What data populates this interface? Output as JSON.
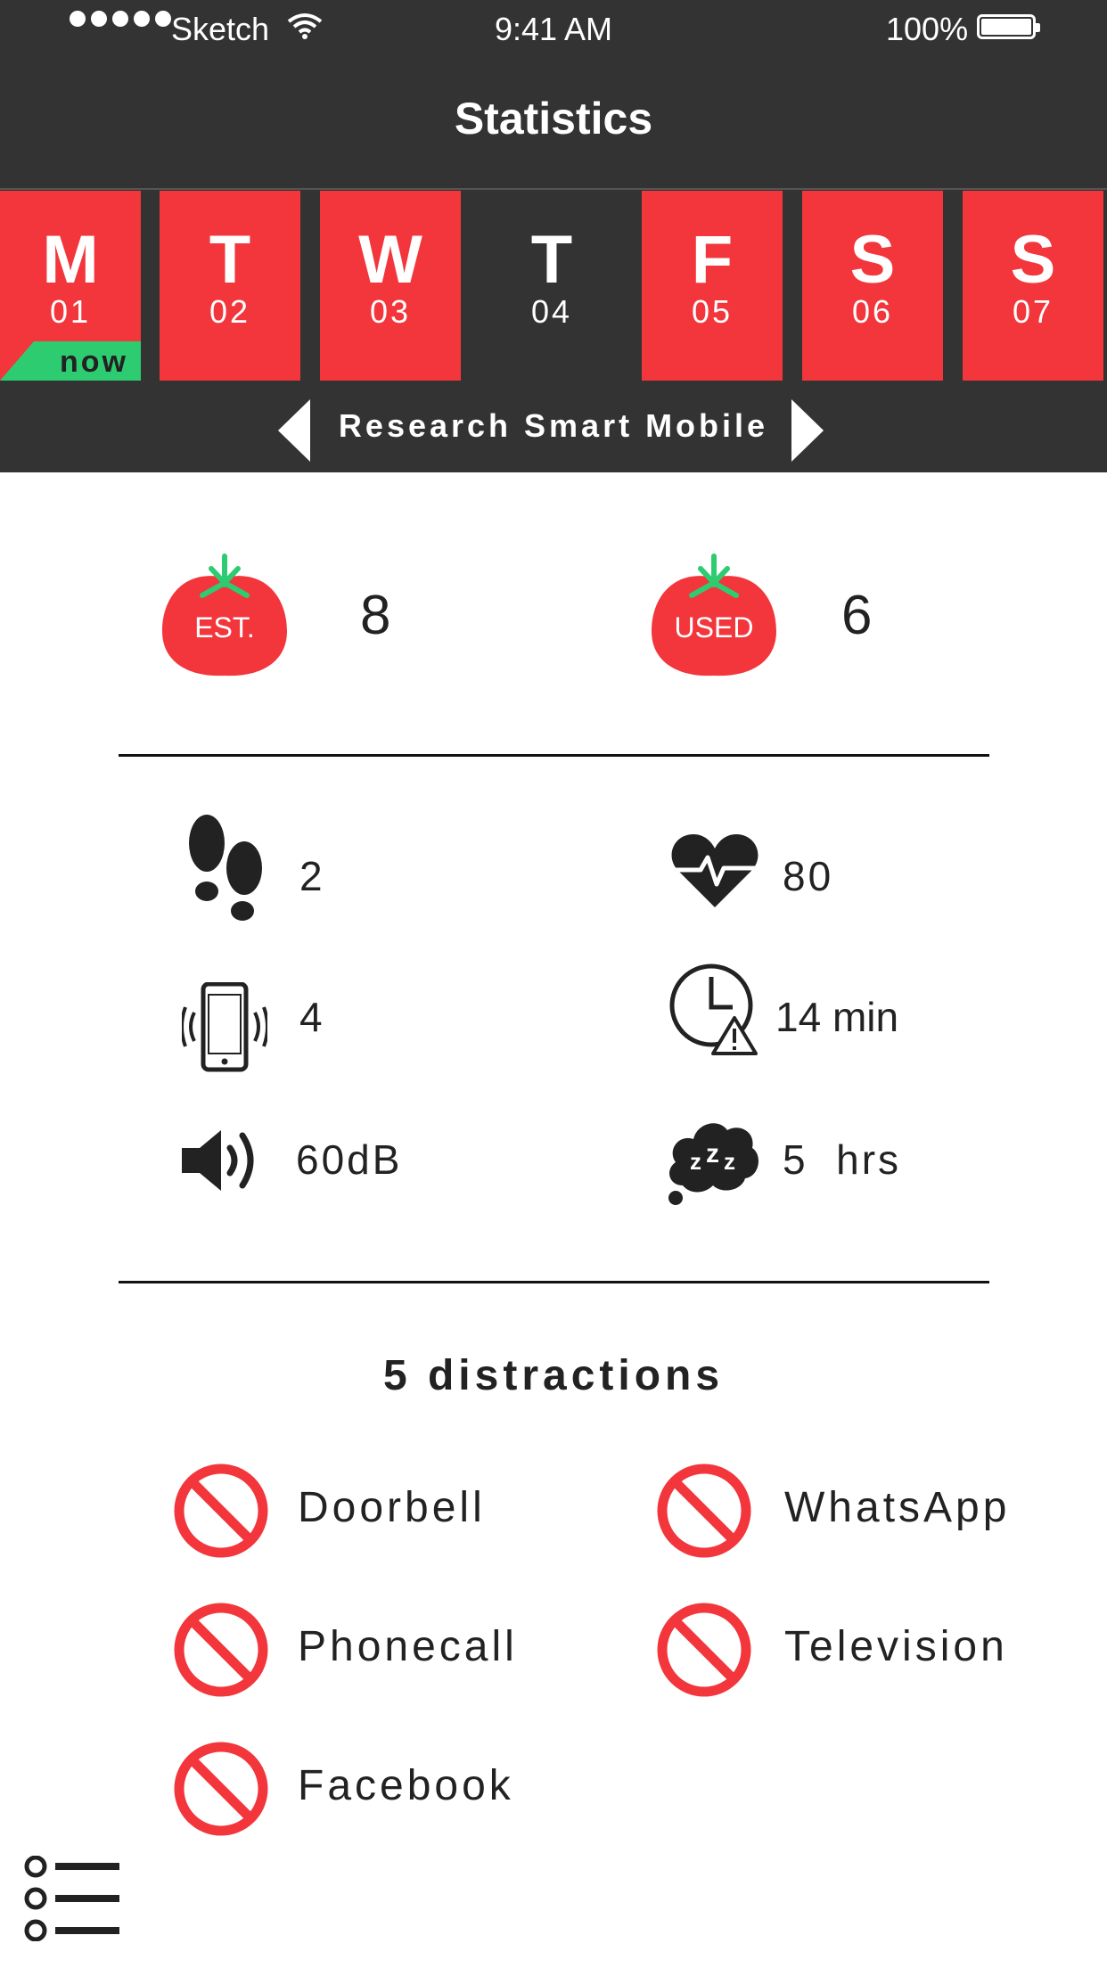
{
  "status_bar": {
    "carrier": "Sketch",
    "time": "9:41 AM",
    "battery_percent": "100%",
    "battery_level": 1.0
  },
  "header": {
    "title": "Statistics"
  },
  "days": [
    {
      "letter": "M",
      "number": "01",
      "selected": true,
      "badge": "now"
    },
    {
      "letter": "T",
      "number": "02",
      "selected": true
    },
    {
      "letter": "W",
      "number": "03",
      "selected": true
    },
    {
      "letter": "T",
      "number": "04",
      "selected": false
    },
    {
      "letter": "F",
      "number": "05",
      "selected": true
    },
    {
      "letter": "S",
      "number": "06",
      "selected": true
    },
    {
      "letter": "S",
      "number": "07",
      "selected": true
    }
  ],
  "project": {
    "name": "Research Smart Mobile"
  },
  "pomodoros": {
    "estimated_label": "EST.",
    "estimated_value": "8",
    "used_label": "USED",
    "used_value": "6"
  },
  "metrics": {
    "steps": "2",
    "heart_rate": "80",
    "phone_pickups": "4",
    "late_time": "14 min",
    "noise": "60dB",
    "sleep": "5  hrs"
  },
  "distractions": {
    "title": "5 distractions",
    "items": [
      "Doorbell",
      "WhatsApp",
      "Phonecall",
      "Television",
      "Facebook"
    ]
  },
  "icons": {
    "steps": "footprints-icon",
    "heart_rate": "heartbeat-icon",
    "phone": "vibrating-phone-icon",
    "late": "clock-warning-icon",
    "noise": "speaker-icon",
    "sleep": "sleep-cloud-icon",
    "distraction": "prohibited-icon",
    "menu": "list-menu-icon"
  },
  "colors": {
    "accent_red": "#f2363b",
    "header_dark": "#333333",
    "now_green": "#2ecc71",
    "tomato_leaf": "#2ecc71"
  }
}
